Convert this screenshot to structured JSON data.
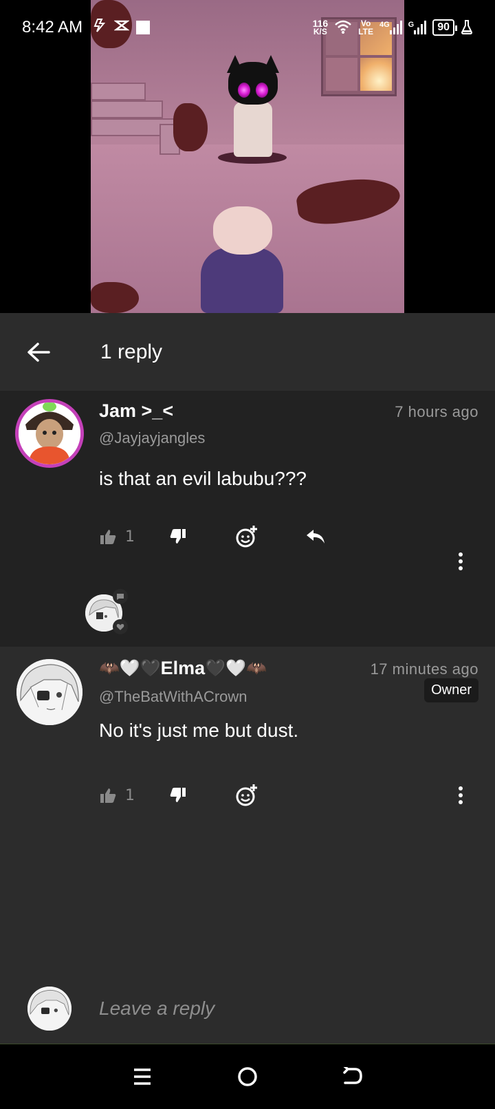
{
  "status_bar": {
    "time": "8:42 AM",
    "speed_value": "116",
    "speed_unit": "K/S",
    "volte_top": "Vo",
    "volte_bottom": "LTE",
    "net_4g": "4G",
    "net_g": "G",
    "battery": "90"
  },
  "header": {
    "title": "1 reply",
    "back_icon": "arrow-left-icon"
  },
  "comments": [
    {
      "author": "Jam >_<",
      "handle": "@Jayjayjangles",
      "timestamp": "7 hours ago",
      "body": "is that an evil labubu???",
      "likes": "1",
      "avatar_border": "#c440b9"
    },
    {
      "author_prefix": "🦇🤍🖤",
      "author": "Elma",
      "author_suffix": "🖤🤍🦇",
      "handle": "@TheBatWithACrown",
      "timestamp": "17 minutes ago",
      "badge": "Owner",
      "body": "No it's just me but dust.",
      "likes": "1"
    }
  ],
  "reply_bar": {
    "placeholder": "Leave a reply"
  },
  "colors": {
    "header_bg": "#2c2c2c",
    "comment_bg": "#222222",
    "muted_text": "#9a9a9a"
  }
}
